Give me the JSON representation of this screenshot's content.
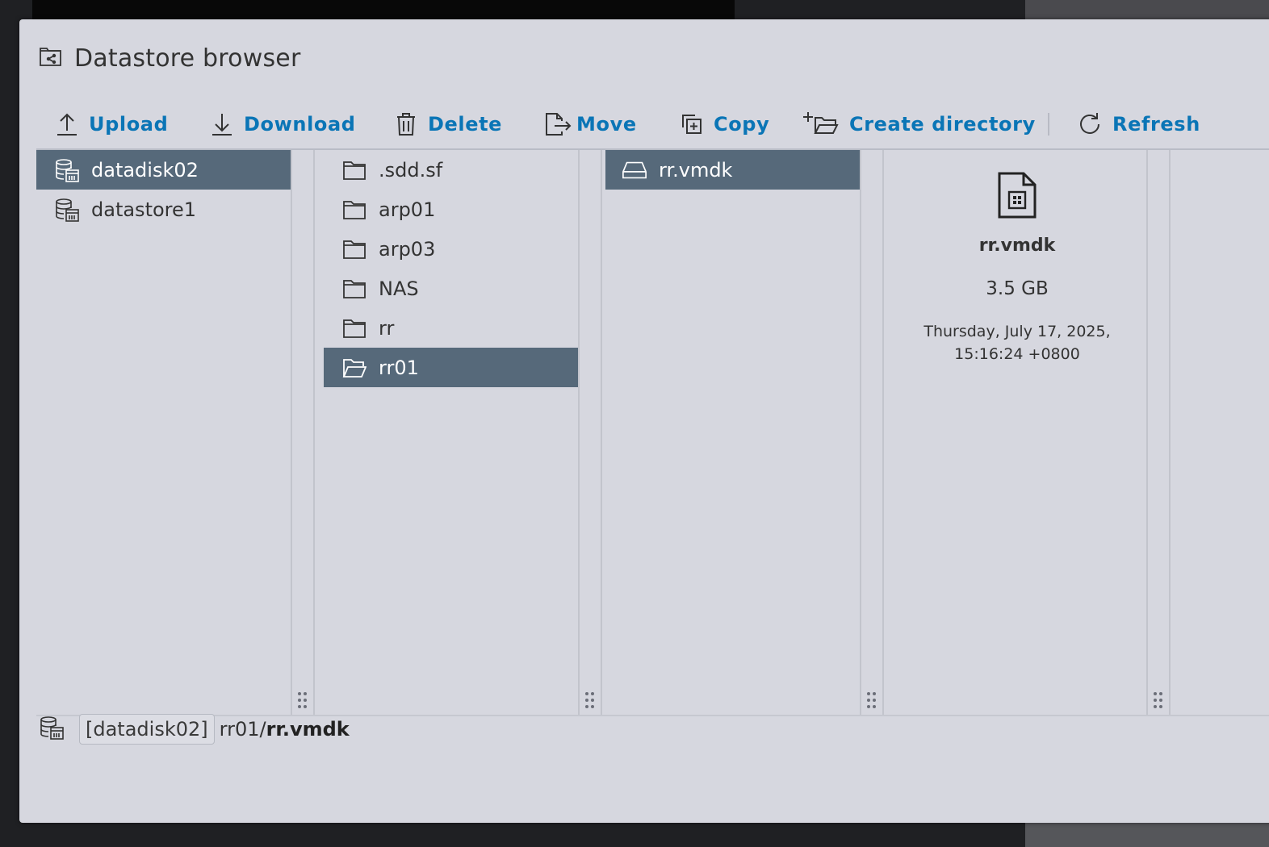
{
  "dialog": {
    "title": "Datastore browser"
  },
  "toolbar": {
    "upload": "Upload",
    "download": "Download",
    "delete": "Delete",
    "move": "Move",
    "copy": "Copy",
    "create_directory": "Create directory",
    "refresh": "Refresh"
  },
  "datastores": [
    {
      "name": "datadisk02",
      "selected": true
    },
    {
      "name": "datastore1",
      "selected": false
    }
  ],
  "folders": [
    {
      "name": ".sdd.sf",
      "selected": false
    },
    {
      "name": "arp01",
      "selected": false
    },
    {
      "name": "arp03",
      "selected": false
    },
    {
      "name": "NAS",
      "selected": false
    },
    {
      "name": "rr",
      "selected": false
    },
    {
      "name": "rr01",
      "selected": true
    }
  ],
  "files": [
    {
      "name": "rr.vmdk",
      "selected": true
    }
  ],
  "details": {
    "name": "rr.vmdk",
    "size": "3.5 GB",
    "modified_line1": "Thursday, July 17, 2025,",
    "modified_line2": "15:16:24 +0800"
  },
  "status": {
    "datastore": "[datadisk02]",
    "path": "rr01/",
    "file": "rr.vmdk"
  },
  "colors": {
    "accent": "#0a75b6",
    "selection": "#56697a",
    "panel_bg": "#d6d7df"
  },
  "icons": {
    "title": "folder-share-icon",
    "datastore": "datastore-icon",
    "folder": "folder-icon",
    "folder_open": "folder-open-icon",
    "disk": "hard-disk-icon",
    "file_detail": "vmdk-file-icon"
  }
}
